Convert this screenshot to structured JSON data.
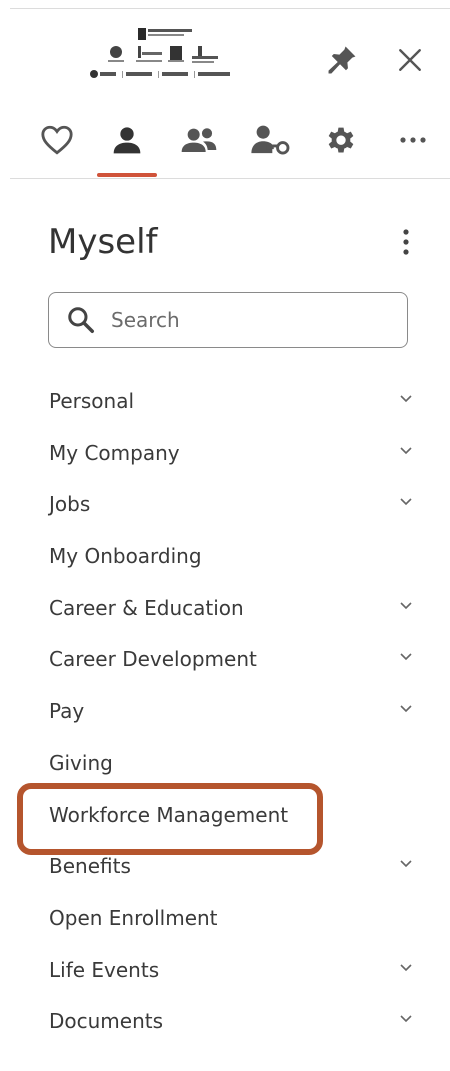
{
  "logo": {
    "icon": "company-logo-icon"
  },
  "header": {
    "pin_icon": "pin-icon",
    "close_icon": "close-icon"
  },
  "tabs": [
    {
      "name": "favorites",
      "icon": "heart-icon",
      "active": false
    },
    {
      "name": "myself",
      "icon": "person-icon",
      "active": true
    },
    {
      "name": "my-team",
      "icon": "people-icon",
      "active": false
    },
    {
      "name": "security",
      "icon": "person-key-icon",
      "active": false
    },
    {
      "name": "settings",
      "icon": "gear-icon",
      "active": false
    },
    {
      "name": "more",
      "icon": "ellipsis-icon",
      "active": false
    }
  ],
  "section": {
    "title": "Myself"
  },
  "search": {
    "placeholder": "Search",
    "value": ""
  },
  "menu": {
    "items": [
      {
        "label": "Personal",
        "expandable": true
      },
      {
        "label": "My Company",
        "expandable": true
      },
      {
        "label": "Jobs",
        "expandable": true
      },
      {
        "label": "My Onboarding",
        "expandable": false
      },
      {
        "label": "Career & Education",
        "expandable": true
      },
      {
        "label": "Career Development",
        "expandable": true
      },
      {
        "label": "Pay",
        "expandable": true
      },
      {
        "label": "Giving",
        "expandable": false
      },
      {
        "label": "Workforce Management",
        "expandable": false
      },
      {
        "label": "Benefits",
        "expandable": true
      },
      {
        "label": "Open Enrollment",
        "expandable": false
      },
      {
        "label": "Life Events",
        "expandable": true
      },
      {
        "label": "Documents",
        "expandable": true
      }
    ]
  },
  "colors": {
    "accent": "#d0533a",
    "highlight": "#b5552d",
    "text": "#333333",
    "icon": "#555555"
  }
}
